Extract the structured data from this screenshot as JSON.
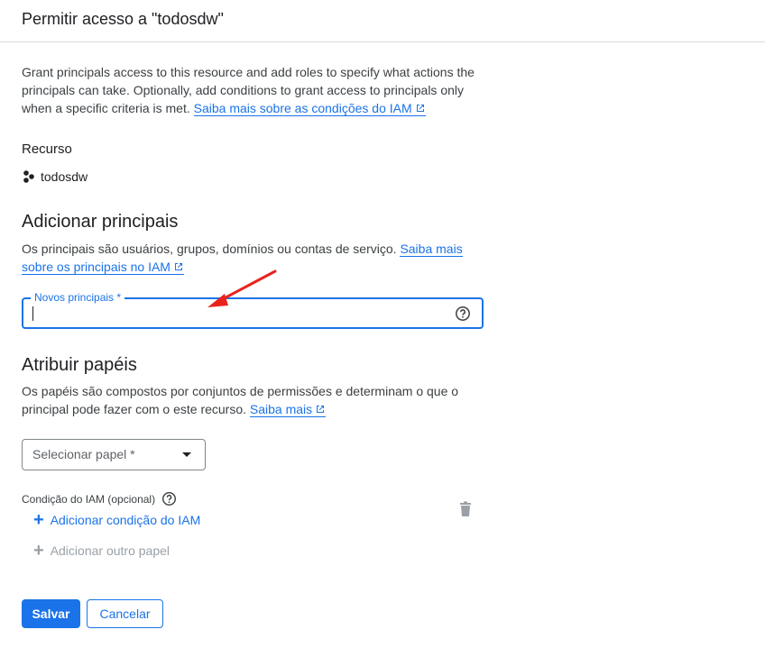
{
  "header": {
    "title": "Permitir acesso a \"todosdw\""
  },
  "intro": {
    "text": "Grant principals access to this resource and add roles to specify what actions the principals can take. Optionally, add conditions to grant access to principals only when a specific criteria is met.",
    "link": "Saiba mais sobre as condições do IAM"
  },
  "resource": {
    "label": "Recurso",
    "name": "todosdw",
    "icon": "project-nodes-icon"
  },
  "principals": {
    "heading": "Adicionar principais",
    "description": "Os principais são usuários, grupos, domínios ou contas de serviço.",
    "link": "Saiba mais sobre os principais no IAM",
    "field_label": "Novos principais *",
    "field_value": ""
  },
  "roles": {
    "heading": "Atribuir papéis",
    "description": "Os papéis são compostos por conjuntos de permissões e determinam o que o principal pode fazer com o este recurso.",
    "link": "Saiba mais",
    "select_placeholder": "Selecionar papel *",
    "condition_label": "Condição do IAM (opcional)",
    "add_condition": "Adicionar condição do IAM",
    "add_role": "Adicionar outro papel"
  },
  "actions": {
    "save": "Salvar",
    "cancel": "Cancelar"
  },
  "colors": {
    "accent": "#1a73e8",
    "annotation_arrow": "#e8231c",
    "disabled": "#9aa0a6"
  }
}
